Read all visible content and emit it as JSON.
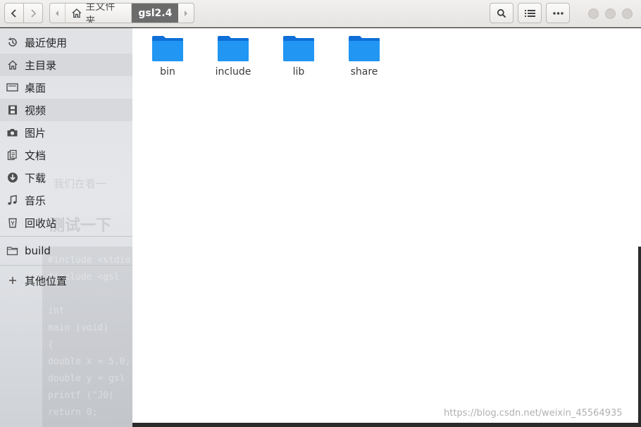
{
  "header": {
    "home_label": "主文件夹",
    "current_folder": "gsl2.4",
    "icons": {
      "back": "chevron-left-icon",
      "forward": "chevron-right-icon",
      "search": "search-icon",
      "view": "list-view-icon",
      "menu": "more-icon"
    }
  },
  "sidebar": {
    "items": [
      {
        "label": "最近使用",
        "icon": "recent-icon"
      },
      {
        "label": "主目录",
        "icon": "home-icon"
      },
      {
        "label": "桌面",
        "icon": "desktop-icon"
      },
      {
        "label": "视频",
        "icon": "video-icon"
      },
      {
        "label": "图片",
        "icon": "camera-icon"
      },
      {
        "label": "文档",
        "icon": "document-icon"
      },
      {
        "label": "下载",
        "icon": "download-icon"
      },
      {
        "label": "音乐",
        "icon": "music-icon"
      },
      {
        "label": "回收站",
        "icon": "trash-icon"
      }
    ],
    "bookmark": {
      "label": "build",
      "icon": "folder-icon"
    },
    "other_locations": {
      "label": "其他位置",
      "icon": "plus-icon"
    }
  },
  "files": [
    {
      "name": "bin"
    },
    {
      "name": "include"
    },
    {
      "name": "lib"
    },
    {
      "name": "share"
    }
  ],
  "watermark": "https://blog.csdn.net/weixin_45564935",
  "background_text": {
    "bullet": "我们在看一",
    "heading": "测试一下",
    "code": [
      "#include <stdio",
      "#include <gsl",
      "",
      "int",
      "main (void)",
      "{",
      "  double x = 5.0;",
      "  double y = gsl",
      "  printf (\"J0(",
      "  return 0;"
    ]
  },
  "colors": {
    "folder_blue": "#1e88f0",
    "path_active": "#6b6b6b"
  }
}
